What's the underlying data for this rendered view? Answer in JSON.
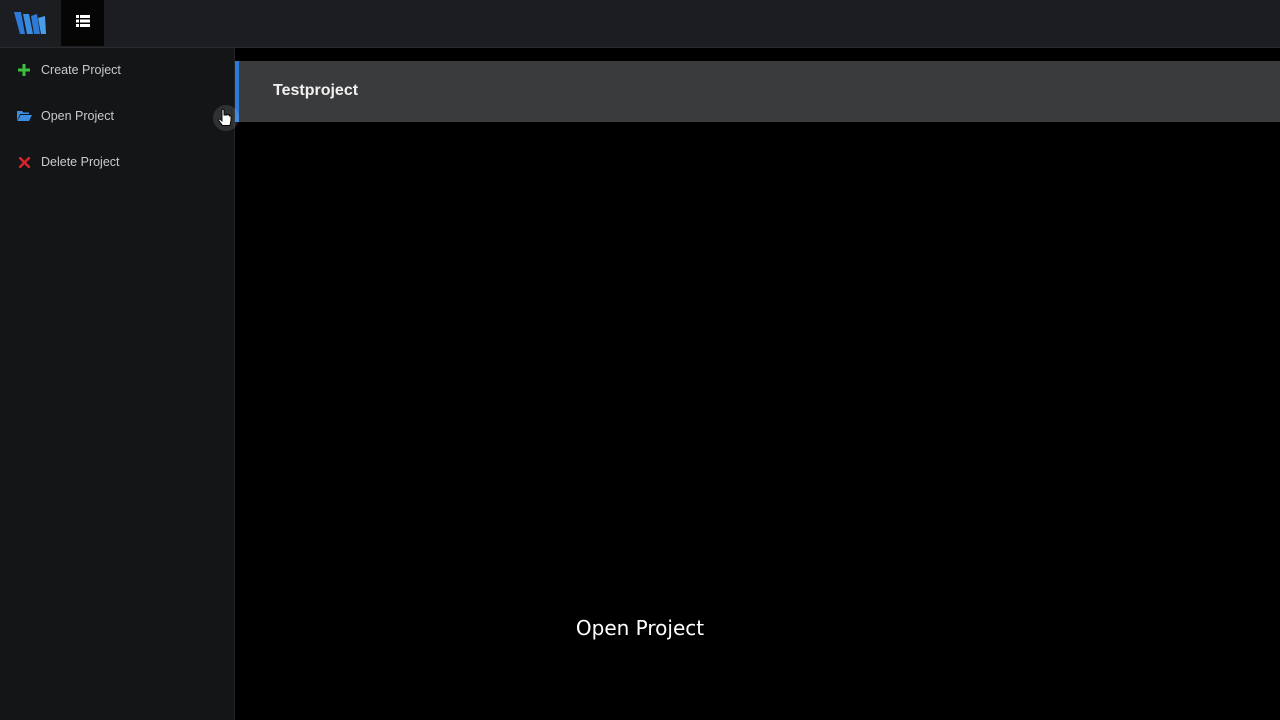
{
  "colors": {
    "accent": "#2e7ad8",
    "create_icon": "#3fbf3f",
    "open_icon": "#3b8fe0",
    "delete_icon": "#d9232a"
  },
  "header": {
    "logo_icon": "wm-logo-icon",
    "menu_icon": "list-icon"
  },
  "sidebar": {
    "items": [
      {
        "label": "Create Project",
        "icon": "plus-icon"
      },
      {
        "label": "Open Project",
        "icon": "folder-open-icon"
      },
      {
        "label": "Delete Project",
        "icon": "close-icon"
      }
    ]
  },
  "projects": [
    {
      "name": "Testproject"
    }
  ],
  "caption": "Open Project"
}
